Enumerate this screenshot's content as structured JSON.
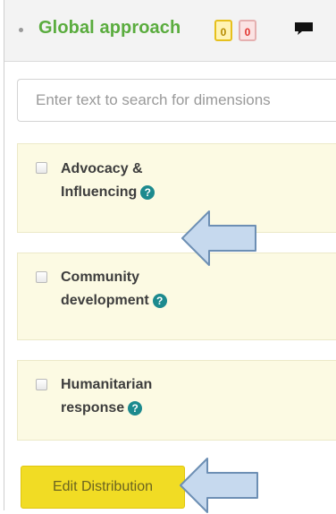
{
  "header": {
    "title": "Global approach",
    "badge_yellow": "0",
    "badge_red": "0",
    "comment_icon": "speech-bubble-icon"
  },
  "search": {
    "placeholder": "Enter text to search for dimensions",
    "value": ""
  },
  "dimensions": [
    {
      "line1": "Advocacy &",
      "line2": "Influencing",
      "checked": false
    },
    {
      "line1": "Community",
      "line2": "development",
      "checked": false
    },
    {
      "line1": "Humanitarian",
      "line2": "response",
      "checked": false
    }
  ],
  "help_glyph": "?",
  "actions": {
    "edit_distribution": "Edit Distribution"
  },
  "colors": {
    "title_green": "#5aac3e",
    "card_bg": "#fcfae3",
    "button_yellow": "#f1dc24",
    "help_teal": "#1c8a8e",
    "arrow_fill": "#c6d9ee",
    "arrow_stroke": "#6d8fb4"
  }
}
